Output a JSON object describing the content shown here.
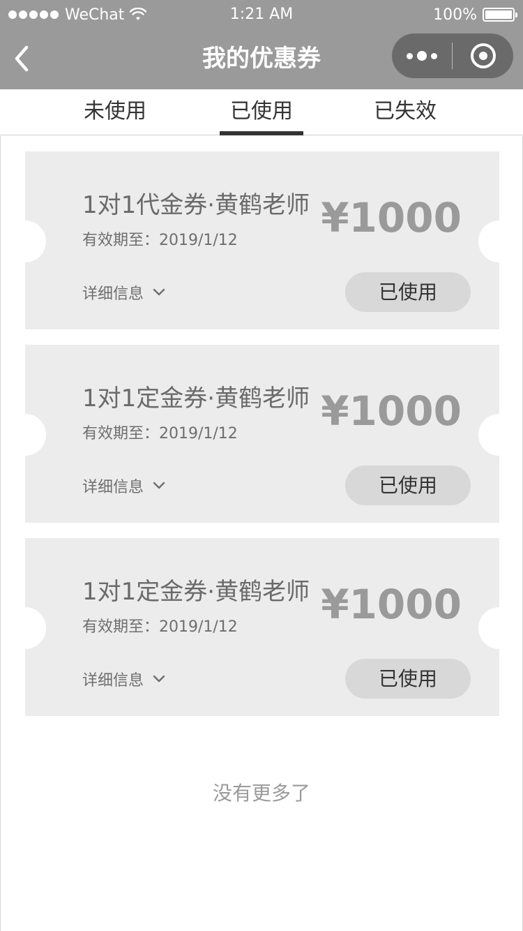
{
  "status_bar": {
    "carrier": "WeChat",
    "time": "1:21 AM",
    "battery": "100%",
    "wifi_icon": "wifi-icon",
    "battery_icon": "battery-icon"
  },
  "nav": {
    "title": "我的优惠券",
    "back_icon": "chevron-left-icon",
    "more_icon": "more-dots-icon",
    "close_icon": "target-close-icon"
  },
  "tabs": [
    {
      "label": "未使用",
      "active": false
    },
    {
      "label": "已使用",
      "active": true
    },
    {
      "label": "已失效",
      "active": false
    }
  ],
  "coupons": [
    {
      "title": "1对1代金券·黄鹤老师",
      "expiry": "有效期至：2019/1/12",
      "amount": "¥1000",
      "details_label": "详细信息",
      "status": "已使用"
    },
    {
      "title": "1对1定金券·黄鹤老师",
      "expiry": "有效期至：2019/1/12",
      "amount": "¥1000",
      "details_label": "详细信息",
      "status": "已使用"
    },
    {
      "title": "1对1定金券·黄鹤老师",
      "expiry": "有效期至：2019/1/12",
      "amount": "¥1000",
      "details_label": "详细信息",
      "status": "已使用"
    }
  ],
  "footer": {
    "no_more": "没有更多了"
  },
  "colors": {
    "header_bg": "#9a9a9a",
    "capsule_bg": "#6a6a6a",
    "coupon_bg": "#ececec",
    "status_button_bg": "#d8d8d8",
    "amount_text": "#9a9a9a"
  }
}
